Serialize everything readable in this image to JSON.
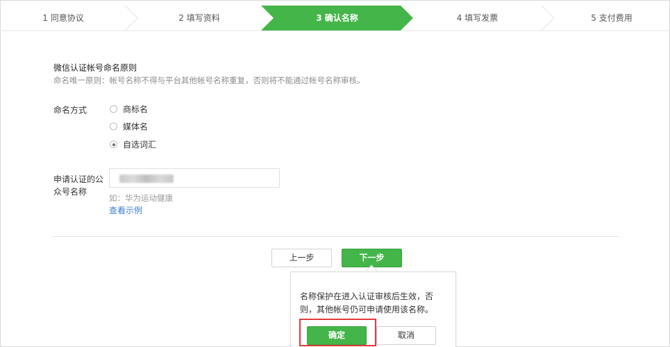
{
  "steps": [
    {
      "label": "1 同意协议",
      "state": "done"
    },
    {
      "label": "2 填写资料",
      "state": "done"
    },
    {
      "label": "3 确认名称",
      "state": "active"
    },
    {
      "label": "4 填写发票",
      "state": "todo"
    },
    {
      "label": "5 支付费用",
      "state": "todo"
    }
  ],
  "colors": {
    "accent": "#44b549",
    "link": "#3b7ed3",
    "highlight": "#e23a3a"
  },
  "principle": {
    "title": "微信认证帐号命名原则",
    "desc": "命名唯一原则：帐号名称不得与平台其他帐号名称重复，否则将不能通过帐号名称审核。"
  },
  "naming": {
    "label": "命名方式",
    "options": [
      {
        "label": "商标名",
        "checked": false
      },
      {
        "label": "媒体名",
        "checked": false
      },
      {
        "label": "自选词汇",
        "checked": true
      }
    ]
  },
  "account_name": {
    "label_line1": "申请认证的公",
    "label_line2": "众号名称",
    "hint": "如：华为运动健康",
    "example_link": "查看示例"
  },
  "nav": {
    "prev": "上一步",
    "next": "下一步"
  },
  "popover": {
    "text": "名称保护在进入认证审核后生效，否则，其他帐号仍可申请使用该名称。",
    "confirm": "确定",
    "cancel": "取消"
  }
}
